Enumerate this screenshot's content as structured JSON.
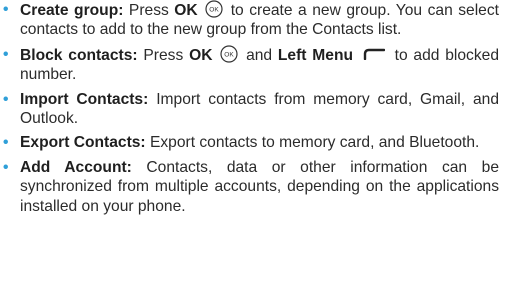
{
  "bullet_char": "•",
  "accent_color": "#2f9fd8",
  "items": [
    {
      "term": "Create group:",
      "text_1": " Press ",
      "key_1": "OK",
      "text_2": " to create a new group. You can select contacts to add to the new group from the Contacts list."
    },
    {
      "term": "Block contacts:",
      "text_1": " Press ",
      "key_1": "OK",
      "text_2": " and ",
      "key_2": "Left Menu",
      "text_3": " to add blocked number."
    },
    {
      "term": "Import Contacts:",
      "text_1": " Import contacts from memory card, Gmail, and Outlook."
    },
    {
      "term": "Export Contacts:",
      "text_1": " Export contacts to memory card, and Bluetooth."
    },
    {
      "term": "Add Account:",
      "text_1": " Contacts, data or other information can be synchronized from multiple accounts, depending on the applications installed on your phone."
    }
  ],
  "icons": {
    "ok_button": "ok-button-icon",
    "left_menu": "left-menu-softkey-icon"
  }
}
